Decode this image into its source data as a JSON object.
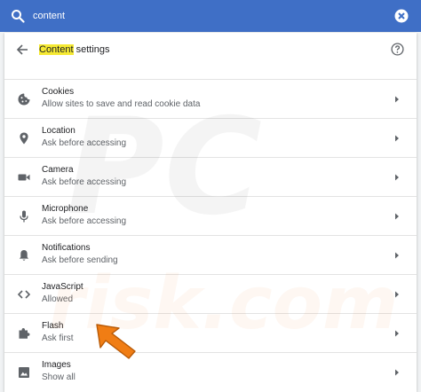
{
  "search": {
    "query": "content"
  },
  "header": {
    "title_highlight": "Content",
    "title_rest": " settings"
  },
  "rows": [
    {
      "title": "Cookies",
      "subtitle": "Allow sites to save and read cookie data",
      "icon": "cookie-icon"
    },
    {
      "title": "Location",
      "subtitle": "Ask before accessing",
      "icon": "location-pin-icon"
    },
    {
      "title": "Camera",
      "subtitle": "Ask before accessing",
      "icon": "camera-icon"
    },
    {
      "title": "Microphone",
      "subtitle": "Ask before accessing",
      "icon": "microphone-icon"
    },
    {
      "title": "Notifications",
      "subtitle": "Ask before sending",
      "icon": "bell-icon"
    },
    {
      "title": "JavaScript",
      "subtitle": "Allowed",
      "icon": "code-brackets-icon"
    },
    {
      "title": "Flash",
      "subtitle": "Ask first",
      "icon": "puzzle-piece-icon"
    },
    {
      "title": "Images",
      "subtitle": "Show all",
      "icon": "image-icon"
    }
  ],
  "watermark": {
    "text": "PC risk.com"
  },
  "colors": {
    "topbar": "#3f6fc6",
    "highlight": "#f5e933",
    "arrow": "#f07d14",
    "icon": "#5f6368"
  }
}
